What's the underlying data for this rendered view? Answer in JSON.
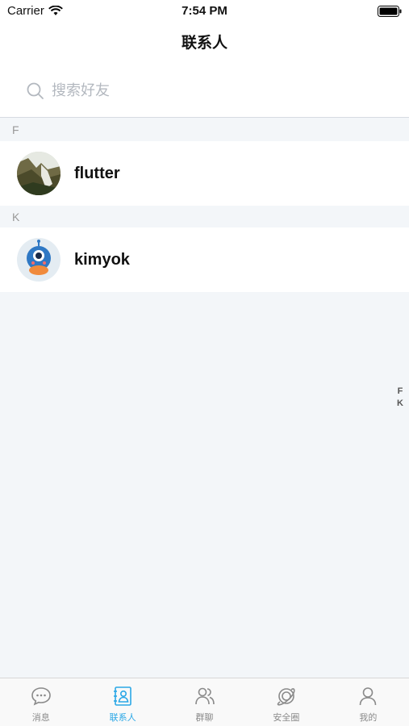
{
  "status_bar": {
    "carrier": "Carrier",
    "time": "7:54 PM"
  },
  "nav": {
    "title": "联系人"
  },
  "search": {
    "placeholder": "搜索好友"
  },
  "sections": [
    {
      "letter": "F",
      "contacts": [
        {
          "name": "flutter",
          "avatar": "landscape-photo"
        }
      ]
    },
    {
      "letter": "K",
      "contacts": [
        {
          "name": "kimyok",
          "avatar": "robot-mascot"
        }
      ]
    }
  ],
  "index": [
    "F",
    "K"
  ],
  "tabs": [
    {
      "label": "消息",
      "icon": "chat-icon",
      "active": false
    },
    {
      "label": "联系人",
      "icon": "contacts-icon",
      "active": true
    },
    {
      "label": "群聊",
      "icon": "group-icon",
      "active": false
    },
    {
      "label": "安全圈",
      "icon": "planet-icon",
      "active": false
    },
    {
      "label": "我的",
      "icon": "person-icon",
      "active": false
    }
  ],
  "colors": {
    "accent": "#2aa7e6",
    "background": "#f3f6f9",
    "inactive": "#8a8a8a"
  }
}
